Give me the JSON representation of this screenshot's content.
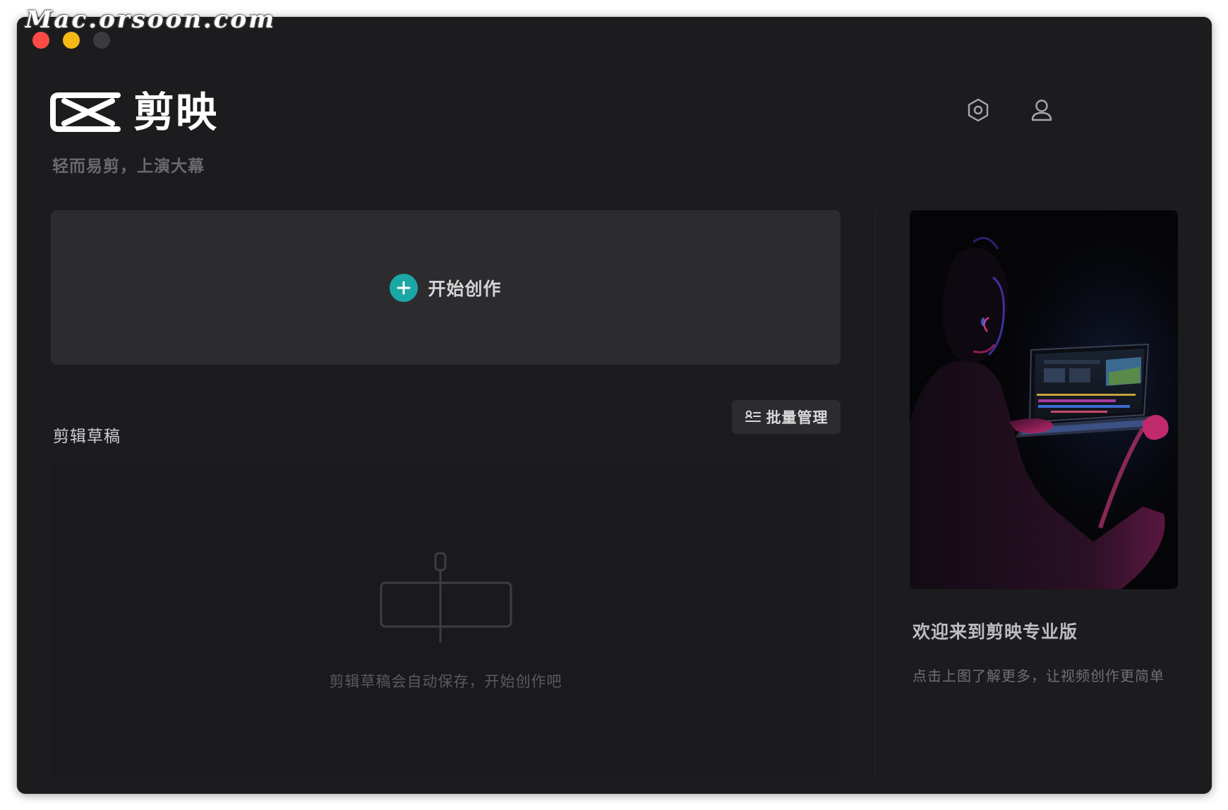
{
  "watermark": "Mac.orsoon.com",
  "app": {
    "name": "剪映",
    "tagline": "轻而易剪，上演大幕"
  },
  "header": {
    "settings_icon": "settings-hexagon-icon",
    "account_icon": "user-account-icon"
  },
  "create": {
    "label": "开始创作",
    "accent": "#1aa7a6"
  },
  "drafts": {
    "title": "剪辑草稿",
    "batch_label": "批量管理",
    "empty_text": "剪辑草稿会自动保存，开始创作吧"
  },
  "promo": {
    "title": "欢迎来到剪映专业版",
    "subtitle": "点击上图了解更多，让视频创作更简单"
  },
  "colors": {
    "window_bg": "#1c1c1e",
    "card_bg": "#2c2c2e",
    "close": "#ff4b46",
    "minimize": "#f5b914",
    "maximize": "#3b3b3d"
  }
}
